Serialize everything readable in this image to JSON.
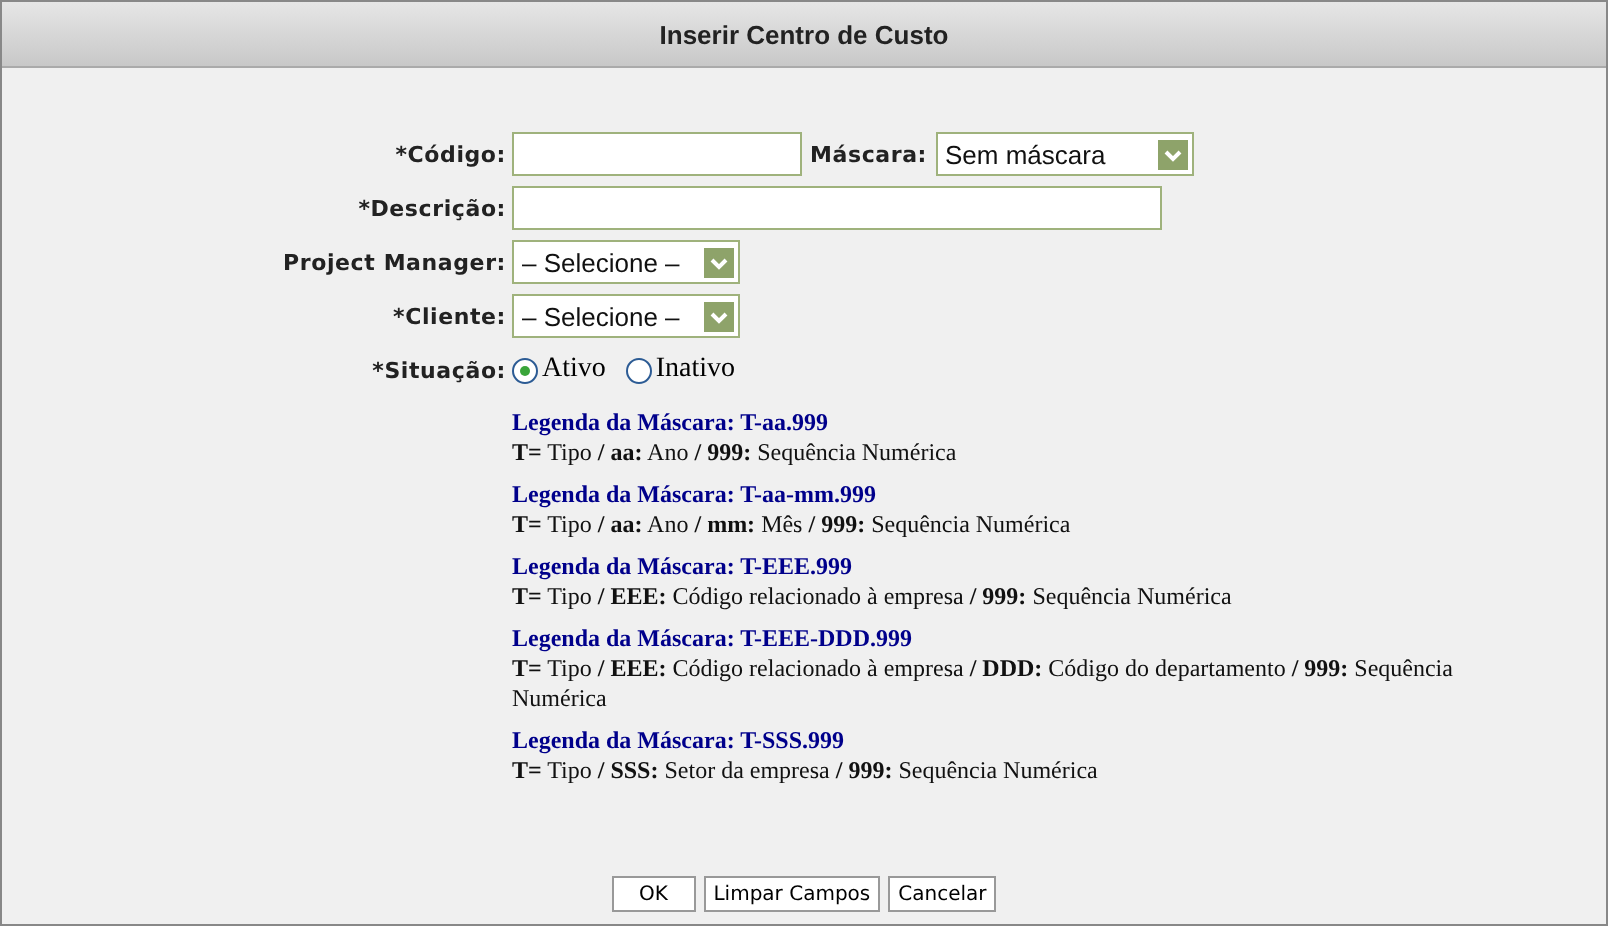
{
  "window": {
    "title": "Inserir Centro de Custo"
  },
  "fields": [
    {
      "kind": "short_text",
      "label": "*Código:",
      "extra": {
        "label": "Máscara:",
        "value": "Sem máscara"
      }
    },
    {
      "kind": "long_text",
      "label": "*Descrição:"
    },
    {
      "kind": "select",
      "label": "Project Manager:",
      "value": "– Selecione –"
    },
    {
      "kind": "select",
      "label": "*Cliente:",
      "value": "– Selecione –"
    },
    {
      "kind": "radio",
      "label": "*Situação:",
      "options": [
        {
          "label": "Ativo",
          "selected": true
        },
        {
          "label": "Inativo",
          "selected": false
        }
      ]
    }
  ],
  "legends": [
    {
      "title": "Legenda da Máscara: T-aa.999",
      "text": "**T=** Tipo **/ aa:** Ano **/ 999:** Sequência Numérica"
    },
    {
      "title": "Legenda da Máscara: T-aa-mm.999",
      "text": "**T=** Tipo **/ aa:** Ano **/ mm:** Mês **/ 999:** Sequência Numérica"
    },
    {
      "title": "Legenda da Máscara: T-EEE.999",
      "text": "**T=** Tipo **/ EEE:** Código relacionado à empresa **/ 999:** Sequência Numérica"
    },
    {
      "title": "Legenda da Máscara: T-EEE-DDD.999",
      "text": "**T=** Tipo **/ EEE:** Código relacionado à empresa **/ DDD:** Código do departamento **/ 999:** Sequência Numérica"
    },
    {
      "title": "Legenda da Máscara: T-SSS.999",
      "text": "**T=** Tipo **/ SSS:** Setor da empresa **/ 999:** Sequência Numérica"
    }
  ],
  "buttons": [
    "OK",
    "Limpar Campos",
    "Cancelar"
  ]
}
